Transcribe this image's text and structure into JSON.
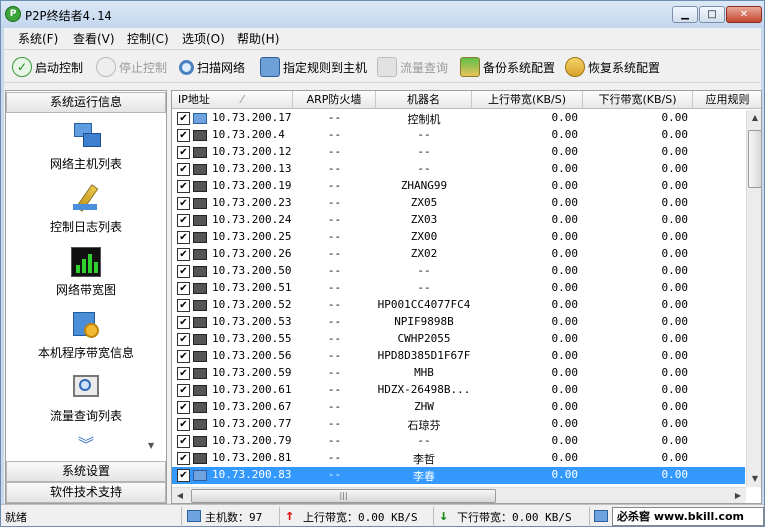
{
  "window": {
    "title": "P2P终结者4.14",
    "min_label": "▁",
    "max_label": "□",
    "close_label": "✕"
  },
  "menu": [
    {
      "label": "系统(F)"
    },
    {
      "label": "查看(V)"
    },
    {
      "label": "控制(C)"
    },
    {
      "label": "选项(O)"
    },
    {
      "label": "帮助(H)"
    }
  ],
  "toolbar": [
    {
      "label": "启动控制",
      "icon": "check-icon",
      "enabled": true
    },
    {
      "label": "停止控制",
      "icon": "stop-icon",
      "enabled": false
    },
    {
      "label": "扫描网络",
      "icon": "magnifier-icon",
      "enabled": true
    },
    {
      "label": "指定规则到主机",
      "icon": "gear-computer-icon",
      "enabled": true
    },
    {
      "label": "流量查询",
      "icon": "computer-icon",
      "enabled": false
    },
    {
      "label": "备份系统配置",
      "icon": "download-arrow-icon",
      "enabled": true
    },
    {
      "label": "恢复系统配置",
      "icon": "restore-icon",
      "enabled": true
    }
  ],
  "sidebar": {
    "header": "系统运行信息",
    "items": [
      {
        "label": "网络主机列表",
        "icon": "network-hosts-icon"
      },
      {
        "label": "控制日志列表",
        "icon": "pencil-icon"
      },
      {
        "label": "网络带宽图",
        "icon": "bandwidth-chart-icon"
      },
      {
        "label": "本机程序带宽信息",
        "icon": "gear-app-icon"
      },
      {
        "label": "流量查询列表",
        "icon": "monitor-search-icon"
      }
    ],
    "footer_sections": [
      "系统设置",
      "软件技术支持"
    ]
  },
  "table": {
    "columns": [
      "IP地址",
      "ARP防火墙",
      "机器名",
      "上行带宽(KB/S)",
      "下行带宽(KB/S)",
      "应用规则"
    ],
    "rows": [
      {
        "ip": "10.73.200.17",
        "arp": "--",
        "name": "控制机",
        "up": "0.00",
        "down": "0.00",
        "self": true
      },
      {
        "ip": "10.73.200.4",
        "arp": "--",
        "name": "--",
        "up": "0.00",
        "down": "0.00"
      },
      {
        "ip": "10.73.200.12",
        "arp": "--",
        "name": "--",
        "up": "0.00",
        "down": "0.00"
      },
      {
        "ip": "10.73.200.13",
        "arp": "--",
        "name": "--",
        "up": "0.00",
        "down": "0.00"
      },
      {
        "ip": "10.73.200.19",
        "arp": "--",
        "name": "ZHANG99",
        "up": "0.00",
        "down": "0.00"
      },
      {
        "ip": "10.73.200.23",
        "arp": "--",
        "name": "ZX05",
        "up": "0.00",
        "down": "0.00"
      },
      {
        "ip": "10.73.200.24",
        "arp": "--",
        "name": "ZX03",
        "up": "0.00",
        "down": "0.00"
      },
      {
        "ip": "10.73.200.25",
        "arp": "--",
        "name": "ZX00",
        "up": "0.00",
        "down": "0.00"
      },
      {
        "ip": "10.73.200.26",
        "arp": "--",
        "name": "ZX02",
        "up": "0.00",
        "down": "0.00"
      },
      {
        "ip": "10.73.200.50",
        "arp": "--",
        "name": "--",
        "up": "0.00",
        "down": "0.00"
      },
      {
        "ip": "10.73.200.51",
        "arp": "--",
        "name": "--",
        "up": "0.00",
        "down": "0.00"
      },
      {
        "ip": "10.73.200.52",
        "arp": "--",
        "name": "HP001CC4077FC4",
        "up": "0.00",
        "down": "0.00"
      },
      {
        "ip": "10.73.200.53",
        "arp": "--",
        "name": "NPIF9898B",
        "up": "0.00",
        "down": "0.00"
      },
      {
        "ip": "10.73.200.55",
        "arp": "--",
        "name": "CWHP2055",
        "up": "0.00",
        "down": "0.00"
      },
      {
        "ip": "10.73.200.56",
        "arp": "--",
        "name": "HPD8D385D1F67F",
        "up": "0.00",
        "down": "0.00"
      },
      {
        "ip": "10.73.200.59",
        "arp": "--",
        "name": "MHB",
        "up": "0.00",
        "down": "0.00"
      },
      {
        "ip": "10.73.200.61",
        "arp": "--",
        "name": "HDZX-26498B...",
        "up": "0.00",
        "down": "0.00"
      },
      {
        "ip": "10.73.200.67",
        "arp": "--",
        "name": "ZHW",
        "up": "0.00",
        "down": "0.00"
      },
      {
        "ip": "10.73.200.77",
        "arp": "--",
        "name": "石琼芬",
        "up": "0.00",
        "down": "0.00"
      },
      {
        "ip": "10.73.200.79",
        "arp": "--",
        "name": "--",
        "up": "0.00",
        "down": "0.00"
      },
      {
        "ip": "10.73.200.81",
        "arp": "--",
        "name": "李哲",
        "up": "0.00",
        "down": "0.00"
      },
      {
        "ip": "10.73.200.83",
        "arp": "--",
        "name": "李春",
        "up": "0.00",
        "down": "0.00",
        "selected": true
      }
    ]
  },
  "status": {
    "ready": "就绪",
    "host_count": "主机数：97",
    "upload": "上行带宽：0.00 KB/S",
    "download": "下行带宽：0.00 KB/S",
    "watermark": "必杀窖 www.bkill.com"
  },
  "colors": {
    "selected_row": "#3399ff",
    "upload_arrow": "#e01010",
    "download_arrow": "#1a8a1a"
  }
}
